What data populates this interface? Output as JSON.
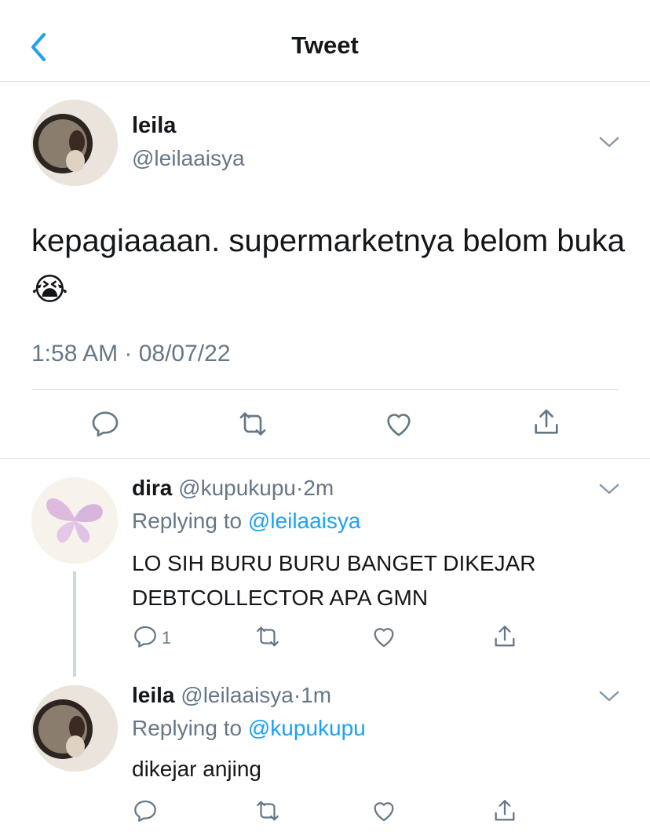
{
  "header": {
    "title": "Tweet"
  },
  "tweet": {
    "display_name": "leila",
    "handle": "@leilaaisya",
    "text": "kepagiaaaan. supermarketnya belom buka😭",
    "timestamp": "1:58 AM · 08/07/22"
  },
  "replies": [
    {
      "display_name": "dira",
      "handle": "@kupukupu",
      "dot": "·",
      "age": "2m",
      "replying_prefix": "Replying to ",
      "replying_to": "@leilaaisya",
      "text": "LO SIH BURU BURU BANGET DIKEJAR DEBTCOLLECTOR APA GMN",
      "reply_count": "1"
    },
    {
      "display_name": "leila",
      "handle": "@leilaaisya",
      "dot": "·",
      "age": "1m",
      "replying_prefix": "Replying to ",
      "replying_to": "@kupukupu",
      "text": "dikejar anjing",
      "reply_count": ""
    }
  ],
  "colors": {
    "accent": "#1da1f2",
    "muted": "#657786",
    "icon": "#657786"
  },
  "icons": [
    "chevron-left-icon",
    "chevron-down-icon",
    "reply-icon",
    "retweet-icon",
    "like-icon",
    "share-icon"
  ]
}
